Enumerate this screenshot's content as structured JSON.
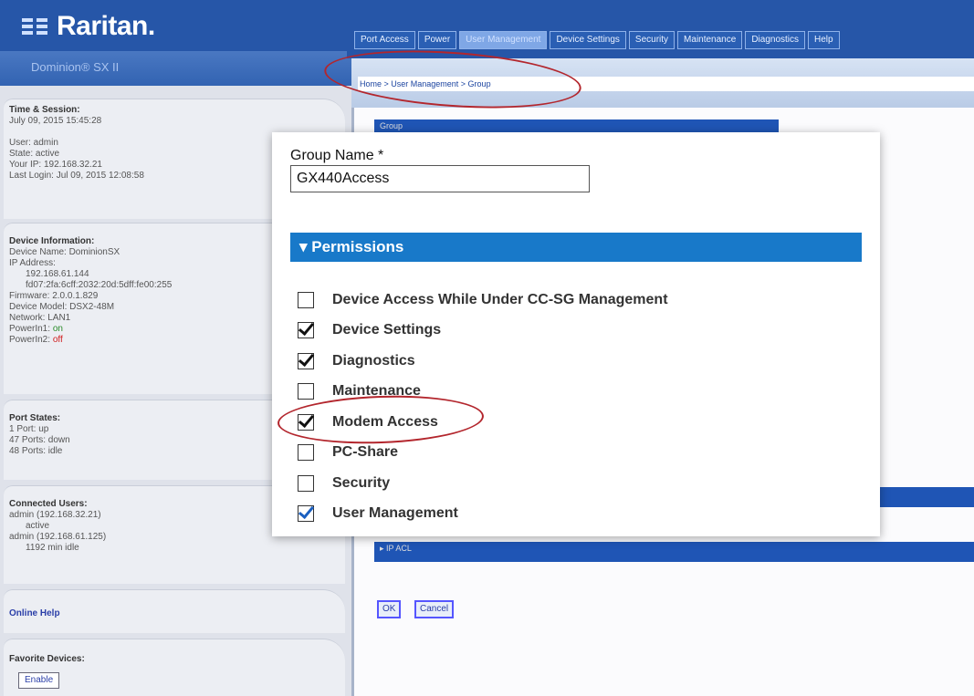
{
  "header": {
    "brand": "Raritan.",
    "product": "Dominion® SX II",
    "tabs": [
      "Port Access",
      "Power",
      "User Management",
      "Device Settings",
      "Security",
      "Maintenance",
      "Diagnostics",
      "Help"
    ],
    "active_tab": "User Management",
    "breadcrumb": "Home > User Management > Group"
  },
  "sidebar": {
    "time_session": {
      "heading": "Time & Session:",
      "datetime": "July 09, 2015 15:45:28",
      "user": "User: admin",
      "state": "State: active",
      "your_ip": "Your IP: 192.168.32.21",
      "last_login": "Last Login: Jul 09, 2015 12:08:58"
    },
    "device_info": {
      "heading": "Device Information:",
      "device_name": "Device Name: DominionSX",
      "ip_address_label": "IP Address:",
      "ipv4": "192.168.61.144",
      "ipv6": "fd07:2fa:6cff:2032:20d:5dff:fe00:255",
      "firmware": "Firmware: 2.0.0.1.829",
      "device_model": "Device Model: DSX2-48M",
      "network": "Network: LAN1",
      "powerin1_label": "PowerIn1:",
      "powerin1_value": "on",
      "powerin2_label": "PowerIn2:",
      "powerin2_value": "off"
    },
    "port_states": {
      "heading": "Port States:",
      "up": "1 Port: up",
      "down": "47 Ports: down",
      "idle": "48 Ports: idle"
    },
    "connected_users": {
      "heading": "Connected Users:",
      "user1": "admin (192.168.32.21)",
      "user1_status": "active",
      "user2": "admin (192.168.61.125)",
      "user2_status": "1192 min idle"
    },
    "online_help": "Online Help",
    "favorite_devices": {
      "heading": "Favorite Devices:",
      "enable_button": "Enable"
    }
  },
  "main": {
    "group_section_label": "Group",
    "ip_acl_label": "IP ACL",
    "ok_button": "OK",
    "cancel_button": "Cancel"
  },
  "modal": {
    "group_name_label": "Group Name *",
    "group_name_value": "GX440Access",
    "permissions_header": "Permissions",
    "permissions": [
      {
        "label": "Device Access While Under CC-SG Management",
        "checked": false
      },
      {
        "label": "Device Settings",
        "checked": true
      },
      {
        "label": "Diagnostics",
        "checked": true
      },
      {
        "label": "Maintenance",
        "checked": false
      },
      {
        "label": "Modem Access",
        "checked": true
      },
      {
        "label": "PC-Share",
        "checked": false
      },
      {
        "label": "Security",
        "checked": false
      },
      {
        "label": "User Management",
        "checked": true
      }
    ]
  },
  "colors": {
    "brand_blue": "#2656a8",
    "permissions_header": "#1879c9",
    "highlight_oval": "#b3262d",
    "power_on": "#2a8c2a",
    "power_off": "#d02020"
  }
}
